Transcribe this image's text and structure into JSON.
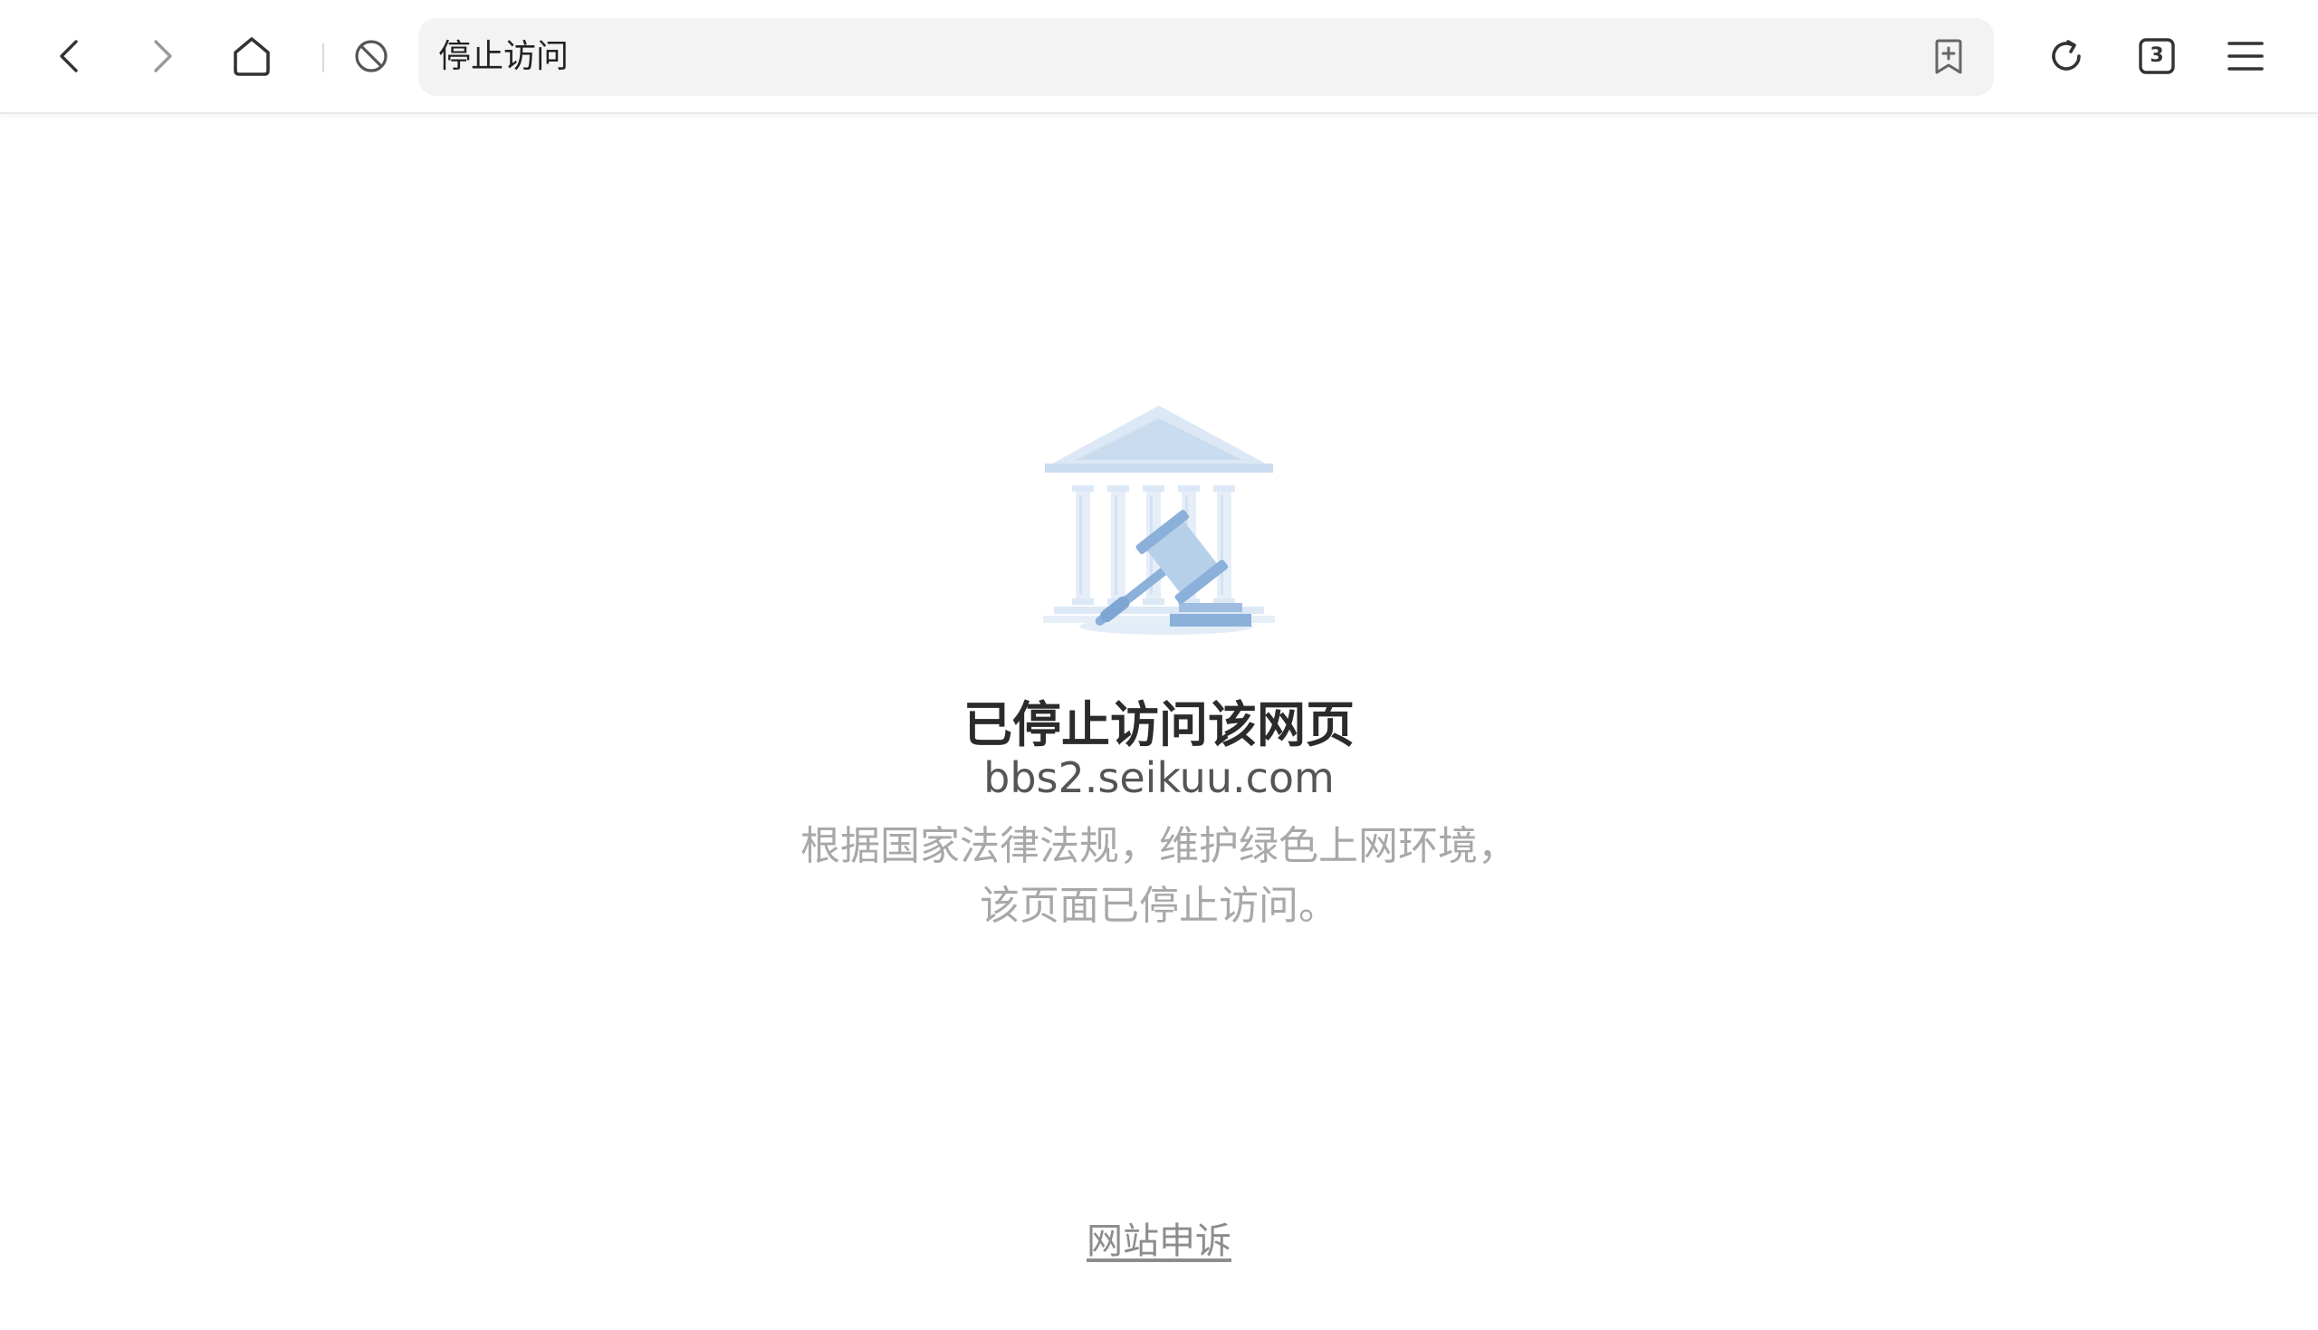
{
  "toolbar": {
    "back_icon": "chevron-left-icon",
    "forward_icon": "chevron-right-icon",
    "home_icon": "home-icon",
    "blocked_icon": "blocked-icon",
    "bookmark_icon": "add-bookmark-icon",
    "refresh_icon": "refresh-icon",
    "tabs_icon": "tabs-icon",
    "tab_count": "3",
    "menu_icon": "menu-icon"
  },
  "address_bar": {
    "text": "停止访问"
  },
  "page": {
    "illustration": "courthouse-gavel-illustration",
    "title": "已停止访问该网页",
    "domain": "bbs2.seikuu.com",
    "description_line1": "根据国家法律法规，维护绿色上网环境，",
    "description_line2": "该页面已停止访问。",
    "appeal_link": "网站申诉"
  },
  "colors": {
    "icon_dark": "#333333",
    "icon_disabled": "#9a9a9a",
    "illustration_light": "#dce8f5",
    "illustration_mid": "#b7d0ea",
    "illustration_dark": "#7fa6d2",
    "title": "#2b2b2b",
    "description": "#a8a8a8"
  }
}
